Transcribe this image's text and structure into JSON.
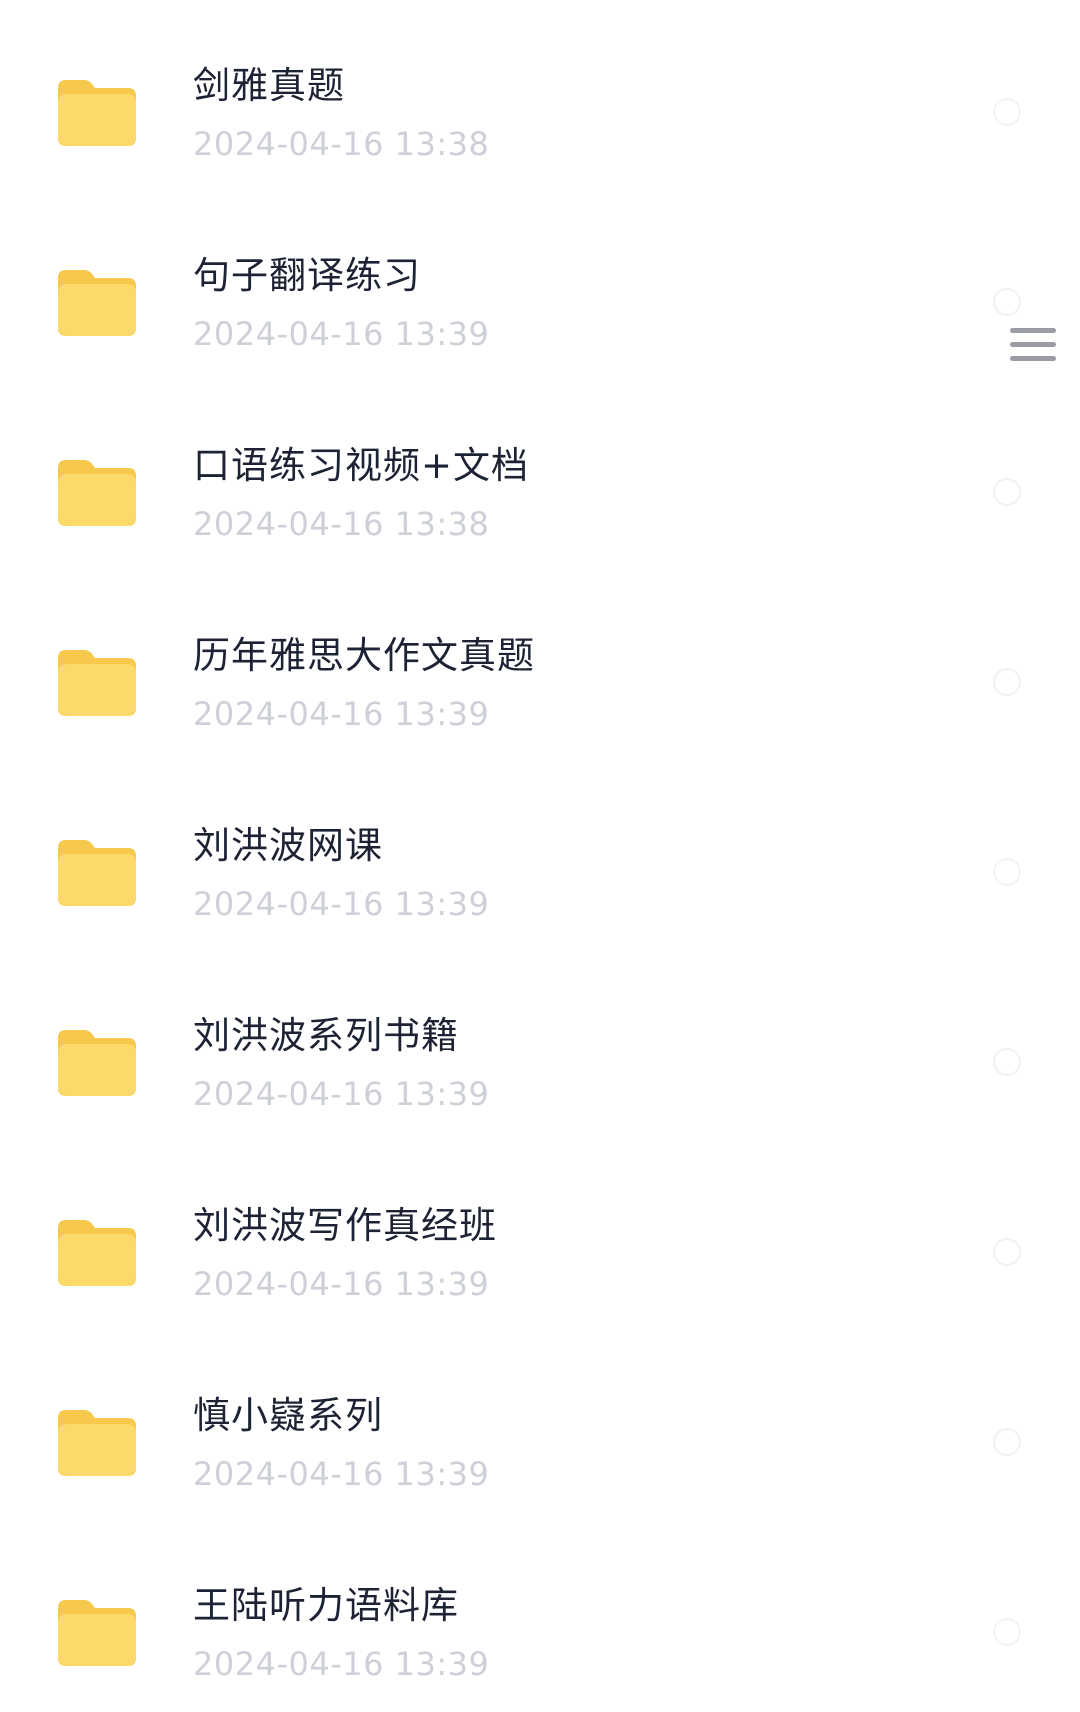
{
  "files": [
    {
      "name": "剑雅真题",
      "date": "2024-04-16 13:38"
    },
    {
      "name": "句子翻译练习",
      "date": "2024-04-16 13:39"
    },
    {
      "name": "口语练习视频+文档",
      "date": "2024-04-16 13:38"
    },
    {
      "name": "历年雅思大作文真题",
      "date": "2024-04-16 13:39"
    },
    {
      "name": "刘洪波网课",
      "date": "2024-04-16 13:39"
    },
    {
      "name": "刘洪波系列书籍",
      "date": "2024-04-16 13:39"
    },
    {
      "name": "刘洪波写作真经班",
      "date": "2024-04-16 13:39"
    },
    {
      "name": "慎小嶷系列",
      "date": "2024-04-16 13:39"
    },
    {
      "name": "王陆听力语料库",
      "date": "2024-04-16 13:39"
    }
  ],
  "icons": {
    "item_icon": "folder-icon",
    "menu_icon": "menu-icon"
  },
  "colors": {
    "folder_body": "#fbd96a",
    "folder_back": "#f6c84c",
    "name_text": "#1d2334",
    "date_text": "#cdd0d8"
  }
}
